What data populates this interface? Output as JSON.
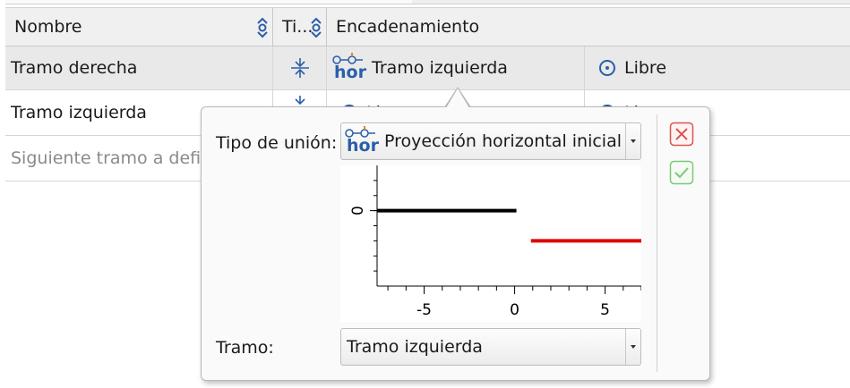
{
  "table": {
    "columns": [
      {
        "label": "Nombre"
      },
      {
        "label": "Ti..."
      },
      {
        "label": "Encadenamiento"
      }
    ],
    "rows": [
      {
        "name": "Tramo derecha",
        "chain": "Tramo izquierda",
        "chain_icon": "hor",
        "status": "Libre"
      },
      {
        "name": "Tramo izquierda",
        "chain": "Li",
        "status": "Li"
      }
    ],
    "new_row_placeholder": "Siguiente tramo a defin"
  },
  "popup": {
    "tipo_label": "Tipo de unión:",
    "tipo_value": "Proyección horizontal inicial",
    "tipo_icon": "hor",
    "tramo_label": "Tramo:",
    "tramo_value": "Tramo izquierda",
    "cancel_icon": "close-icon",
    "accept_icon": "check-icon",
    "colors": {
      "accent": "#2a5ea8",
      "line_a": "#000000",
      "line_b": "#e00000",
      "cancel": "#d9534f",
      "accept": "#7dc77d"
    }
  },
  "chart_data": {
    "type": "line",
    "x_ticks": [
      "-5",
      "0",
      "5"
    ],
    "y_ticks": [
      "0"
    ],
    "xlim": [
      -7.6,
      7
    ],
    "ylim": [
      -2.5,
      1.5
    ],
    "series": [
      {
        "color": "#000000",
        "x": [
          -7.6,
          0.1
        ],
        "y": [
          0,
          0
        ]
      },
      {
        "color": "#e00000",
        "x": [
          0.9,
          7
        ],
        "y": [
          -1,
          -1
        ]
      }
    ]
  }
}
